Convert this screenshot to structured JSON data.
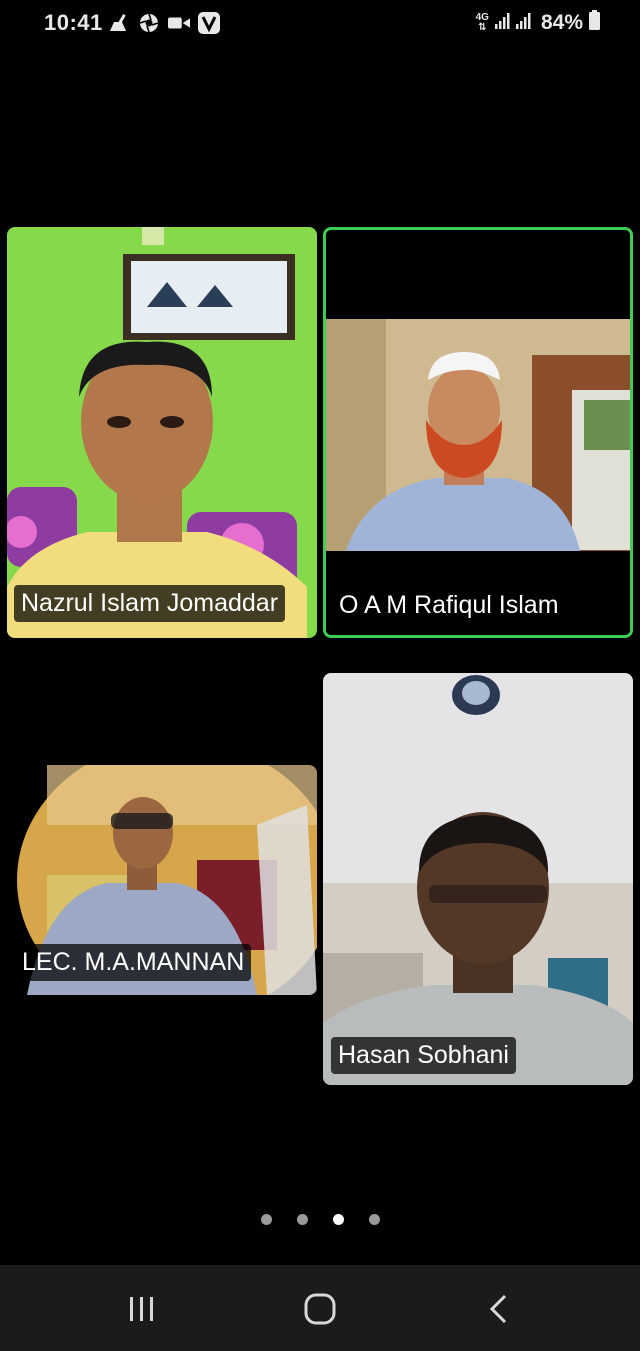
{
  "status_bar": {
    "time": "10:41",
    "left_icons": [
      "broom-icon",
      "aperture-icon",
      "video-icon",
      "v-app-icon"
    ],
    "network": "4G",
    "battery": "84%"
  },
  "participants": [
    {
      "name": "Nazrul Islam Jomaddar",
      "active": false
    },
    {
      "name": "O A M Rafiqul Islam",
      "active": true
    },
    {
      "name": "LEC.  M.A.MANNAN",
      "active": false
    },
    {
      "name": "Hasan Sobhani",
      "active": false
    }
  ],
  "pager": {
    "pages": 4,
    "current": 3
  },
  "nav": [
    "recents-icon",
    "home-icon",
    "back-icon"
  ],
  "colors": {
    "active_border": "#3fcc52",
    "background": "#000000",
    "navbar": "#1b1b1b"
  }
}
